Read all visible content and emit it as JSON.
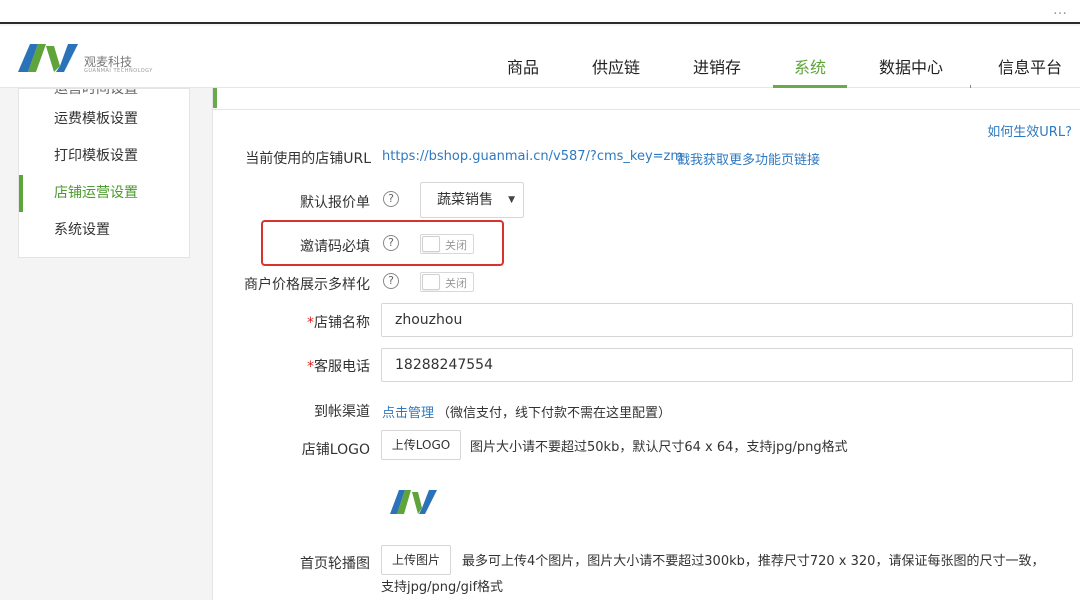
{
  "window": {
    "menu_dots": "…"
  },
  "brand": {
    "name": "观麦科技",
    "sub": "GUANMAI TECHNOLOGY",
    "colors": {
      "green": "#5ea43a",
      "blue": "#2b73b8"
    }
  },
  "nav": {
    "items": [
      {
        "label": "商品"
      },
      {
        "label": "供应链"
      },
      {
        "label": "进销存"
      },
      {
        "label": "系统",
        "active": true
      },
      {
        "label": "数据中心"
      },
      {
        "label": "信息平台"
      }
    ]
  },
  "sidebar": {
    "items": [
      {
        "label": "运营时间设置"
      },
      {
        "label": "运费模板设置"
      },
      {
        "label": "打印模板设置"
      },
      {
        "label": "店铺运营设置",
        "active": true
      },
      {
        "label": "系统设置"
      }
    ]
  },
  "main": {
    "help_link": "如何生效URL?",
    "store_url": {
      "label": "当前使用的店铺URL",
      "value": "https://bshop.guanmai.cn/v587/?cms_key=zm",
      "more_link": "戳我获取更多功能页链接"
    },
    "default_quote": {
      "label": "默认报价单",
      "value": "蔬菜销售",
      "help_icon": "question-circle-icon"
    },
    "invite_code": {
      "label": "邀请码必填",
      "toggle_text": "关闭",
      "help_icon": "question-circle-icon"
    },
    "price_display": {
      "label": "商户价格展示多样化",
      "toggle_text": "关闭",
      "help_icon": "question-circle-icon"
    },
    "store_name": {
      "required_mark": "*",
      "label": "店铺名称",
      "value": "zhouzhou"
    },
    "service_phone": {
      "required_mark": "*",
      "label": "客服电话",
      "value": "18288247554"
    },
    "payment_channel": {
      "label": "到帐渠道",
      "link": "点击管理",
      "note": "（微信支付，线下付款不需在这里配置）"
    },
    "store_logo": {
      "label": "店铺LOGO",
      "button": "上传LOGO",
      "hint": "图片大小请不要超过50kb，默认尺寸64 x 64，支持jpg/png格式"
    },
    "banner": {
      "label": "首页轮播图",
      "button": "上传图片",
      "hint_line1": "最多可上传4个图片，图片大小请不要超过300kb，推荐尺寸720 x 320，请保证每张图的尺寸一致，",
      "hint_line2": "支持jpg/png/gif格式"
    },
    "highlight_color": "#d9322b"
  }
}
